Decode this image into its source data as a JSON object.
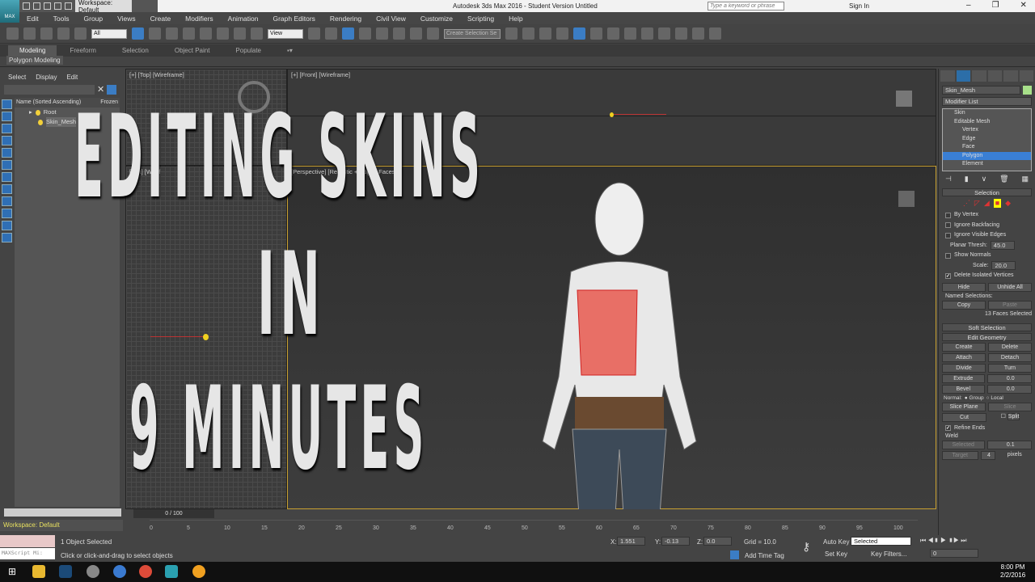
{
  "app": {
    "title": "Autodesk 3ds Max 2016 - Student Version   Untitled",
    "logo": "MAX",
    "workspace": "Workspace: Default",
    "search_placeholder": "Type a keyword or phrase",
    "sign_in": "Sign In"
  },
  "menu": [
    "Edit",
    "Tools",
    "Group",
    "Views",
    "Create",
    "Modifiers",
    "Animation",
    "Graph Editors",
    "Rendering",
    "Civil View",
    "Customize",
    "Scripting",
    "Help"
  ],
  "toolbar": {
    "filter": "All",
    "ref_coord": "View",
    "selection_set": "Create Selection Se"
  },
  "ribbon": {
    "tabs": [
      "Modeling",
      "Freeform",
      "Selection",
      "Object Paint",
      "Populate"
    ],
    "panel": "Polygon Modeling"
  },
  "scene": {
    "menu": [
      "Select",
      "Display",
      "Edit"
    ],
    "column": "Name (Sorted Ascending)",
    "column2": "Frozen",
    "items": [
      "Root",
      "Skin_Mesh"
    ]
  },
  "viewports": {
    "top": "[+] [Top] [Wireframe]",
    "front": "[+] [Front] [Wireframe]",
    "left": "[Left] [Wiref",
    "persp": "[Perspective] [Realistic + Edged Faces]"
  },
  "overlay": {
    "line1": "EDITING SKINS",
    "line2": "IN",
    "line3": "9 MINUTES"
  },
  "panel": {
    "object": "Skin_Mesh",
    "object_color": "#a8e08a",
    "modifier_list": "Modifier List",
    "stack": [
      {
        "label": "Skin",
        "sub": false
      },
      {
        "label": "Editable Mesh",
        "sub": false
      },
      {
        "label": "Vertex",
        "sub": true
      },
      {
        "label": "Edge",
        "sub": true
      },
      {
        "label": "Face",
        "sub": true
      },
      {
        "label": "Polygon",
        "sub": true,
        "selected": true
      },
      {
        "label": "Element",
        "sub": true
      }
    ],
    "selection": {
      "title": "Selection",
      "by_vertex": "By Vertex",
      "ignore_backfacing": "Ignore Backfacing",
      "ignore_visible_edges": "Ignore Visible Edges",
      "planar_label": "Planar Thresh:",
      "planar_value": "45.0",
      "show_normals": "Show Normals",
      "scale_label": "Scale:",
      "scale_value": "20.0",
      "delete_isolated": "Delete Isolated Vertices",
      "hide": "Hide",
      "unhide_all": "Unhide All",
      "named_selections": "Named Selections:",
      "copy": "Copy",
      "paste": "Paste",
      "status": "13 Faces Selected"
    },
    "soft_selection": "Soft Selection",
    "edit_geometry": {
      "title": "Edit Geometry",
      "create": "Create",
      "delete": "Delete",
      "attach": "Attach",
      "detach": "Detach",
      "divide": "Divide",
      "turn": "Turn",
      "extrude": "Extrude",
      "extrude_value": "0.0",
      "bevel": "Bevel",
      "bevel_value": "0.0",
      "normal": "Normal:",
      "group": "Group",
      "local": "Local",
      "slice_plane": "Slice Plane",
      "slice": "Slice",
      "cut": "Cut",
      "split": "Split",
      "refine_ends": "Refine Ends",
      "weld": "Weld",
      "selected": "Selected",
      "selected_value": "0.1",
      "target": "Target",
      "target_value": "4",
      "pixels": "pixels"
    }
  },
  "timeline": {
    "frame": "0 / 100",
    "ticks": [
      "0",
      "5",
      "10",
      "15",
      "20",
      "25",
      "30",
      "35",
      "40",
      "45",
      "50",
      "55",
      "60",
      "65",
      "70",
      "75",
      "80",
      "85",
      "90",
      "95",
      "100"
    ]
  },
  "status": {
    "objects": "1 Object Selected",
    "prompt": "Click or click-and-drag to select objects",
    "maxscript": "MAXScript Mi:",
    "x_label": "X:",
    "x": "1.551",
    "y_label": "Y:",
    "y": "-0.13",
    "z_label": "Z:",
    "z": "0.0",
    "grid": "Grid = 10.0",
    "add_time_tag": "Add Time Tag",
    "auto_key": "Auto Key",
    "set_key": "Set Key",
    "key_mode": "Selected",
    "key_filters": "Key Filters...",
    "frame_field": "0"
  },
  "taskbar": {
    "time": "8:00 PM",
    "date": "2/2/2016"
  }
}
